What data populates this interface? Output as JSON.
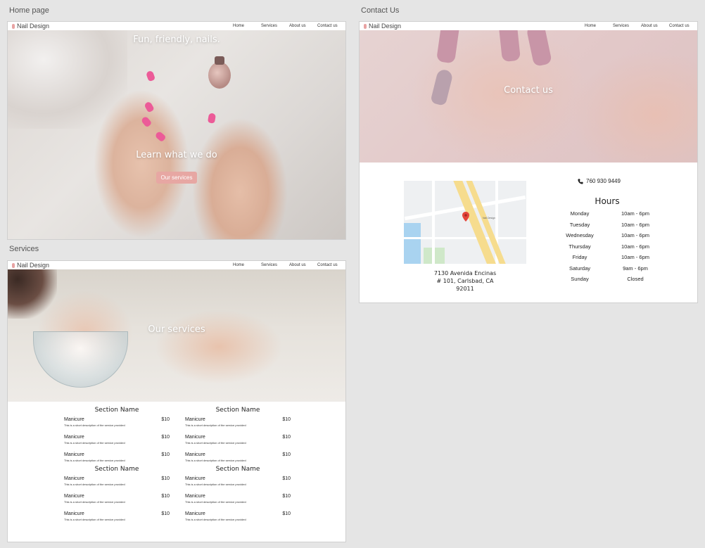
{
  "artboards": {
    "home_label": "Home page",
    "services_label": "Services",
    "contact_label": "Contact Us"
  },
  "brand": "Nail Design",
  "nav": [
    "Home",
    "Services",
    "About us",
    "Contact us"
  ],
  "home": {
    "tagline": "Fun, friendly, nails.",
    "learn_heading": "Learn what we do",
    "cta_label": "Our services"
  },
  "services": {
    "hero_title": "Our services",
    "sections": [
      {
        "name": "Section Name",
        "items": [
          {
            "name": "Manicure",
            "desc": "This is a short description of the service provided",
            "price": "$10"
          },
          {
            "name": "Manicure",
            "desc": "This is a short description of the service provided",
            "price": "$10"
          },
          {
            "name": "Manicure",
            "desc": "This is a short description of the service provided",
            "price": "$10"
          }
        ]
      },
      {
        "name": "Section Name",
        "items": [
          {
            "name": "Manicure",
            "desc": "This is a short description of the service provided",
            "price": "$10"
          },
          {
            "name": "Manicure",
            "desc": "This is a short description of the service provided",
            "price": "$10"
          },
          {
            "name": "Manicure",
            "desc": "This is a short description of the service provided",
            "price": "$10"
          }
        ]
      },
      {
        "name": "Section Name",
        "items": [
          {
            "name": "Manicure",
            "desc": "This is a short description of the service provided",
            "price": "$10"
          },
          {
            "name": "Manicure",
            "desc": "This is a short description of the service provided",
            "price": "$10"
          },
          {
            "name": "Manicure",
            "desc": "This is a short description of the service provided",
            "price": "$10"
          }
        ]
      },
      {
        "name": "Section Name",
        "items": [
          {
            "name": "Manicure",
            "desc": "This is a short description of the service provided",
            "price": "$10"
          },
          {
            "name": "Manicure",
            "desc": "This is a short description of the service provided",
            "price": "$10"
          },
          {
            "name": "Manicure",
            "desc": "This is a short description of the service provided",
            "price": "$10"
          }
        ]
      }
    ]
  },
  "contact": {
    "hero_title": "Contact us",
    "phone_icon": "phone-icon",
    "phone": "760 930 9449",
    "address_line1": "7130 Avenida Encinas",
    "address_line2": "# 101, Carlsbad, CA",
    "address_line3": "92011",
    "hours_title": "Hours",
    "hours": [
      {
        "day": "Monday",
        "time": "10am - 6pm"
      },
      {
        "day": "Tuesday",
        "time": "10am - 6pm"
      },
      {
        "day": "Wednesday",
        "time": "10am - 6pm"
      },
      {
        "day": "Thursday",
        "time": "10am - 6pm"
      },
      {
        "day": "Friday",
        "time": "10am - 6pm"
      },
      {
        "day": "Saturday",
        "time": "9am - 6pm"
      },
      {
        "day": "Sunday",
        "time": "Closed"
      }
    ],
    "map_labels": [
      "Nail Design"
    ]
  },
  "colors": {
    "accent_pink": "#e7a7a3",
    "polish_pink": "#ec5b98",
    "map_pin": "#e3443a"
  }
}
